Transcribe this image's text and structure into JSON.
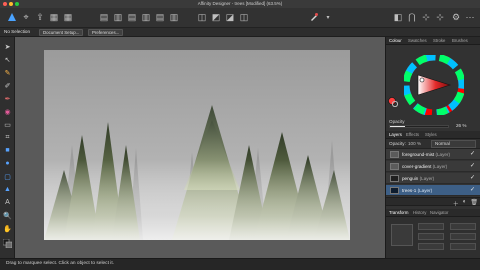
{
  "window": {
    "title": "Affinity Designer - trees [Modified] (63.5%)"
  },
  "context_bar": {
    "selection_label": "No Selection",
    "document_setup_label": "Document Setup...",
    "preferences_label": "Preferences..."
  },
  "right_panel": {
    "color_tabs": [
      "Colour",
      "Swatches",
      "Stroke",
      "Brushes"
    ],
    "opacity_label": "Opacity",
    "opacity_value": "26 %",
    "layers_tabs": [
      "Layers",
      "Effects",
      "Styles"
    ],
    "layer_opacity_label": "Opacity:",
    "layer_opacity_value": "100 %",
    "blend_mode": "Normal",
    "layers": [
      {
        "name": "foreground-mist",
        "type": "(Layer)",
        "checked": true,
        "selected": false
      },
      {
        "name": "cover-gradient",
        "type": "(Layer)",
        "checked": true,
        "selected": false
      },
      {
        "name": "penguin",
        "type": "(Layer)",
        "checked": true,
        "selected": false
      },
      {
        "name": "trees-1",
        "type": "(Layer)",
        "checked": true,
        "selected": true
      }
    ],
    "transform_tabs": [
      "Transform",
      "History",
      "Navigator"
    ]
  },
  "status": {
    "text": "Drag to marquee select. Click an object to select it."
  },
  "colors": {
    "accent": "#3d6fae",
    "panel_bg": "#323232",
    "workspace_bg": "#5a5a5a"
  }
}
